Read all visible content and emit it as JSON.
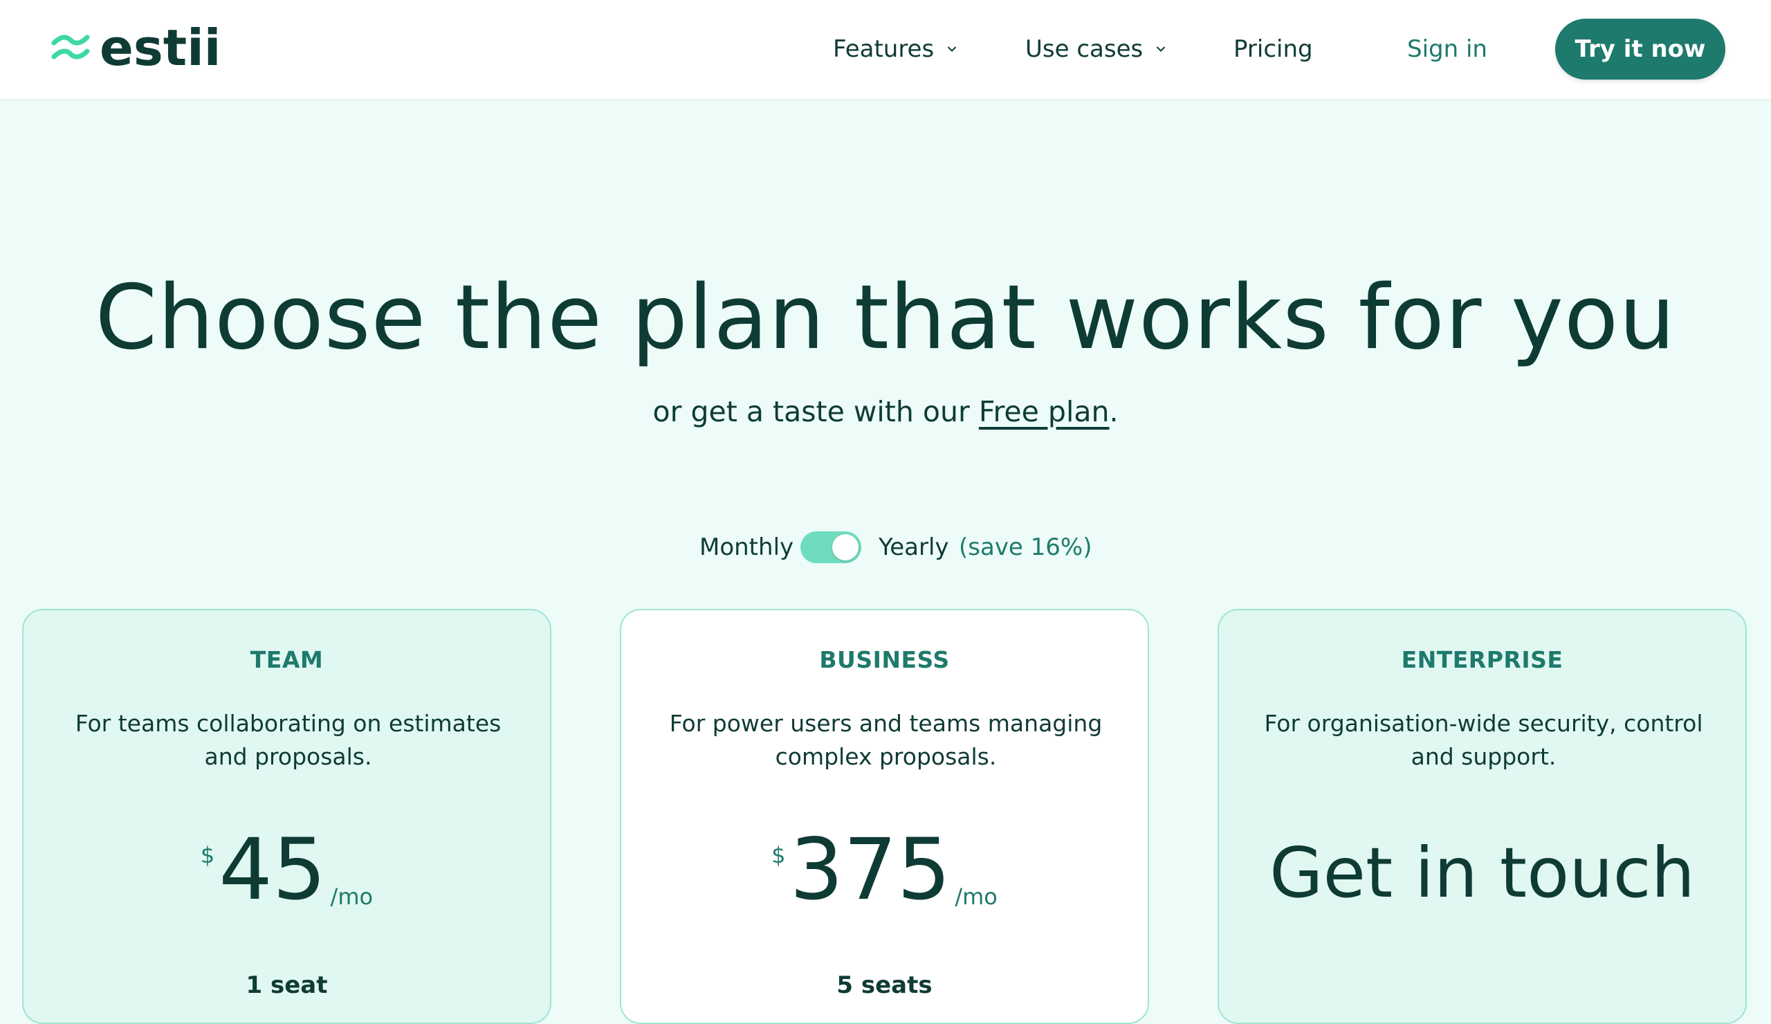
{
  "brand": {
    "name": "estii"
  },
  "nav": {
    "features": "Features",
    "use_cases": "Use cases",
    "pricing": "Pricing",
    "sign_in": "Sign in",
    "cta": "Try it now"
  },
  "hero": {
    "title": "Choose the plan that works for you",
    "sub_prefix": "or get a taste with our ",
    "sub_link": "Free plan",
    "sub_suffix": "."
  },
  "billing": {
    "monthly": "Monthly",
    "yearly": "Yearly",
    "save": "(save 16%)",
    "yearly_selected": true
  },
  "plans": [
    {
      "name": "TEAM",
      "description": "For teams collaborating on estimates and proposals.",
      "currency": "$",
      "price": "45",
      "period": "/mo",
      "seats": "1 seat"
    },
    {
      "name": "BUSINESS",
      "description": "For power users and teams managing complex proposals.",
      "currency": "$",
      "price": "375",
      "period": "/mo",
      "seats": "5 seats"
    },
    {
      "name": "ENTERPRISE",
      "description": "For organisation-wide security, control and support.",
      "price_text": "Get in touch"
    }
  ],
  "colors": {
    "brand_dark": "#0f3b35",
    "accent": "#1e7a6c",
    "toggle": "#6fdcbf",
    "page_bg": "#edfcf8",
    "card_tint": "#e0f8f1",
    "card_border": "#9fe5d2"
  },
  "icons": {
    "logo": "wave-logo-icon",
    "dropdown": "chevron-down-icon"
  }
}
